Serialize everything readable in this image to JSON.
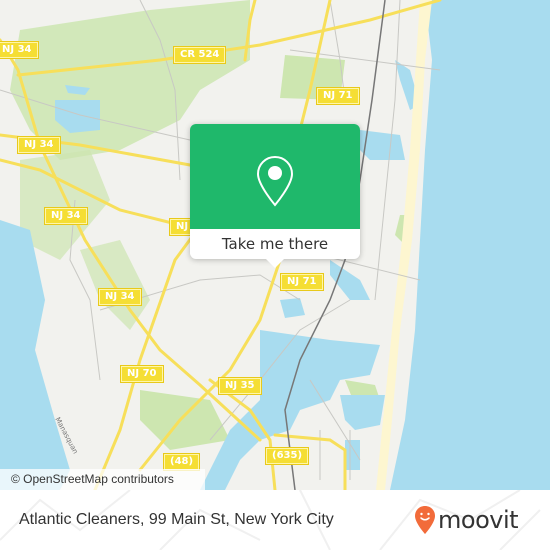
{
  "map": {
    "attribution": "© OpenStreetMap contributors",
    "colors": {
      "land": "#f2f2ee",
      "water": "#a8dcef",
      "park": "#cde6b0",
      "road_major": "#f7df5a",
      "beach": "#fdf6d0",
      "rail": "#777777"
    },
    "road_labels": [
      {
        "id": "nj34-a",
        "text": "NJ 34"
      },
      {
        "id": "cr524",
        "text": "CR 524"
      },
      {
        "id": "nj34-b",
        "text": "NJ 34"
      },
      {
        "id": "nj71-a",
        "text": "NJ 71"
      },
      {
        "id": "nj34-c",
        "text": "NJ 34"
      },
      {
        "id": "nj-partial",
        "text": "NJ"
      },
      {
        "id": "nj71-b",
        "text": "NJ 71"
      },
      {
        "id": "nj34-d",
        "text": "NJ 34"
      },
      {
        "id": "nj70",
        "text": "NJ 70"
      },
      {
        "id": "nj35",
        "text": "NJ 35"
      },
      {
        "id": "r48",
        "text": "(48)"
      },
      {
        "id": "r635",
        "text": "(635)"
      }
    ],
    "water_label": "Manasquan"
  },
  "popup": {
    "icon": "map-pin-icon",
    "button_label": "Take me there",
    "accent": "#1fb86b"
  },
  "footer": {
    "address": "Atlantic Cleaners, 99 Main St, New York City",
    "logo_text": "moovit",
    "logo_icon": "moovit-pin-smile-icon",
    "logo_accent": "#f26b3a"
  }
}
